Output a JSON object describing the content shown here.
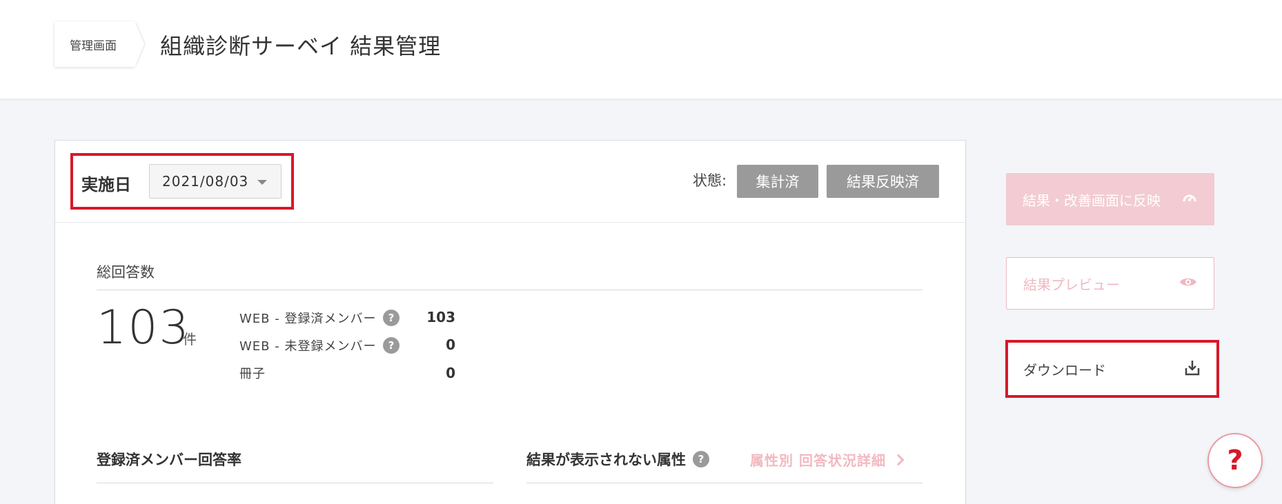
{
  "breadcrumb": {
    "label": "管理画面"
  },
  "header": {
    "title": "組織診断サーベイ 結果管理"
  },
  "date_filter": {
    "label": "実施日",
    "selected": "2021/08/03"
  },
  "status": {
    "label": "状態:",
    "badges": [
      "集計済",
      "結果反映済"
    ]
  },
  "responses": {
    "title": "総回答数",
    "total": "103",
    "unit": "件",
    "breakdown": [
      {
        "label": "WEB - 登録済メンバー",
        "help": "?",
        "value": "103"
      },
      {
        "label": "WEB - 未登録メンバー",
        "help": "?",
        "value": "0"
      },
      {
        "label": "冊子",
        "value": "0"
      }
    ]
  },
  "sections": {
    "rate_title": "登録済メンバー回答率",
    "hidden_attrs_title": "結果が表示されない属性",
    "hidden_attrs_help": "?",
    "detail_link": "属性別 回答状況詳細"
  },
  "side_buttons": {
    "reflect": "結果・改善画面に反映",
    "preview": "結果プレビュー",
    "download": "ダウンロード"
  },
  "fab": {
    "label": "?"
  },
  "colors": {
    "accent_red": "#d7182a",
    "pink_light": "#f2ccd2",
    "badge_gray": "#9a9a9a"
  }
}
